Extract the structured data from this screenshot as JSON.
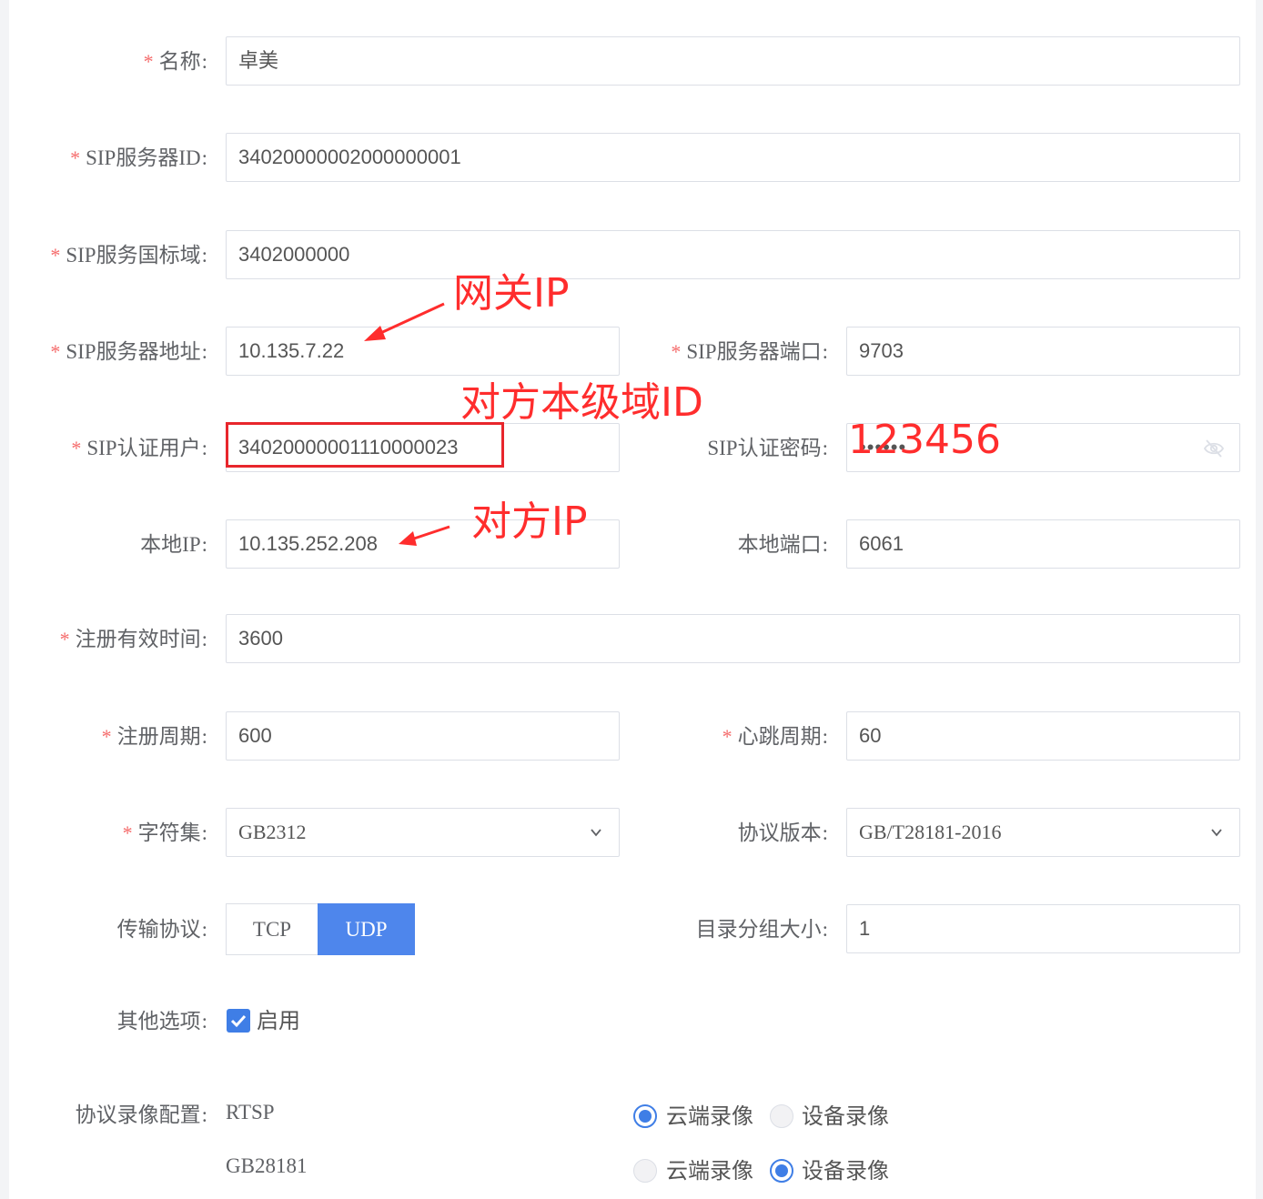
{
  "form": {
    "name": {
      "label": "名称",
      "value": "卓美",
      "required": true
    },
    "sip_server_id": {
      "label": "SIP服务器ID",
      "value": "34020000002000000001",
      "required": true
    },
    "sip_domain": {
      "label": "SIP服务国标域",
      "value": "3402000000",
      "required": true
    },
    "sip_server_addr": {
      "label": "SIP服务器地址",
      "value": "10.135.7.22",
      "required": true
    },
    "sip_server_port": {
      "label": "SIP服务器端口",
      "value": "9703",
      "required": true
    },
    "sip_auth_user": {
      "label": "SIP认证用户",
      "value": "34020000001110000023",
      "required": true
    },
    "sip_auth_password": {
      "label": "SIP认证密码",
      "value": "••••••",
      "required": false
    },
    "local_ip": {
      "label": "本地IP",
      "value": "10.135.252.208",
      "required": false
    },
    "local_port": {
      "label": "本地端口",
      "value": "6061",
      "required": false
    },
    "register_ttl": {
      "label": "注册有效时间",
      "value": "3600",
      "required": true
    },
    "register_period": {
      "label": "注册周期",
      "value": "600",
      "required": true
    },
    "heartbeat_period": {
      "label": "心跳周期",
      "value": "60",
      "required": true
    },
    "charset": {
      "label": "字符集",
      "value": "GB2312",
      "required": true
    },
    "protocol_version": {
      "label": "协议版本",
      "value": "GB/T28181-2016",
      "required": false
    },
    "transport": {
      "label": "传输协议",
      "options": [
        "TCP",
        "UDP"
      ],
      "selected": "UDP"
    },
    "catalog_group_size": {
      "label": "目录分组大小",
      "value": "1"
    },
    "other_options": {
      "label": "其他选项",
      "checkbox_label": "启用",
      "checked": true
    },
    "recording": {
      "label": "协议录像配置",
      "rows": [
        {
          "protocol": "RTSP",
          "options": [
            "云端录像",
            "设备录像"
          ],
          "selected": "云端录像"
        },
        {
          "protocol": "GB28181",
          "options": [
            "云端录像",
            "设备录像"
          ],
          "selected": "设备录像"
        }
      ]
    }
  },
  "annotations": {
    "gateway_ip": "网关IP",
    "peer_domain_id": "对方本级域ID",
    "password_hint": "123456",
    "peer_ip": "对方IP"
  },
  "colors": {
    "primary": "#3f7ee6",
    "required_star": "#f56c6c",
    "annotation": "#ff2d2d"
  }
}
